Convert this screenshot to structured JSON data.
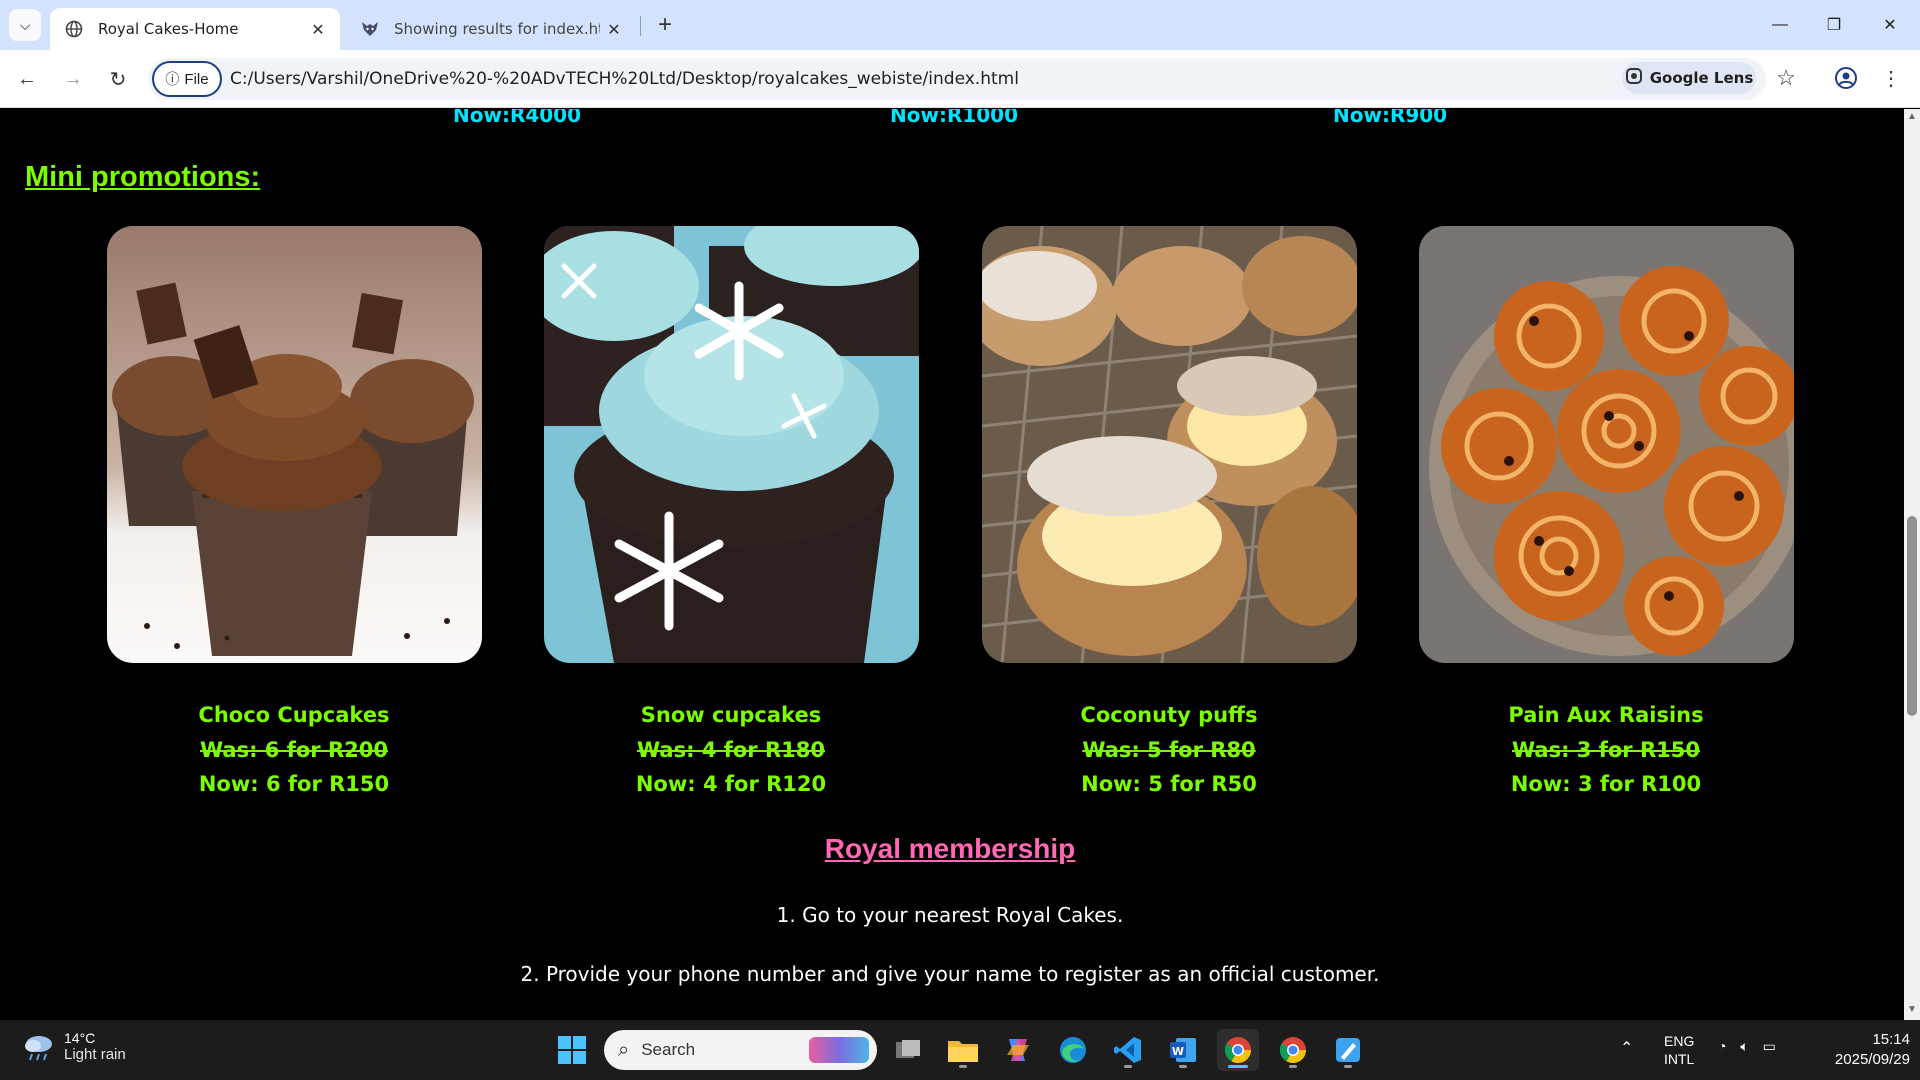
{
  "browser": {
    "tabs": [
      {
        "title": "Royal Cakes-Home",
        "active": true
      },
      {
        "title": "Showing results for index.html",
        "active": false
      }
    ],
    "address": {
      "scheme_label": "File",
      "url": "C:/Users/Varshil/OneDrive%20-%20ADvTECH%20Ltd/Desktop/royalcakes_webiste/index.html"
    },
    "lens_label": "Google Lens"
  },
  "page": {
    "top_prices": [
      "R4000",
      "R1000",
      "R900"
    ],
    "now_label": "Now:",
    "mini_promotions_heading": "Mini promotions:",
    "was_label": "Was:",
    "products": [
      {
        "name": "Choco Cupcakes",
        "was": " 6 for R200",
        "now": " 6 for R150",
        "image": "chocolate-cupcakes"
      },
      {
        "name": "Snow cupcakes",
        "was": " 4 for R180",
        "now": " 4 for R120",
        "image": "snowflake-cupcakes"
      },
      {
        "name": "Coconuty puffs",
        "was": " 5 for R80",
        "now": " 5 for R50",
        "image": "cream-puffs"
      },
      {
        "name": "Pain Aux Raisins",
        "was": " 3 for R150",
        "now": " 3 for R100",
        "image": "raisin-pastries"
      }
    ],
    "membership_heading": "Royal membership",
    "steps": [
      "1. Go to your nearest Royal Cakes.",
      "2. Provide your phone number and give your name to register as an official customer."
    ]
  },
  "taskbar": {
    "weather": {
      "temp": "14°C",
      "condition": "Light rain"
    },
    "search_placeholder": "Search",
    "language": {
      "lang": "ENG",
      "layout": "INTL"
    },
    "clock": {
      "time": "15:14",
      "date": "2025/09/29"
    }
  },
  "colors": {
    "promo_green": "#7cfc00",
    "price_cyan": "#00e5ff",
    "membership_pink": "#ff69b4",
    "tabbar_blue": "#d3e3fd"
  }
}
